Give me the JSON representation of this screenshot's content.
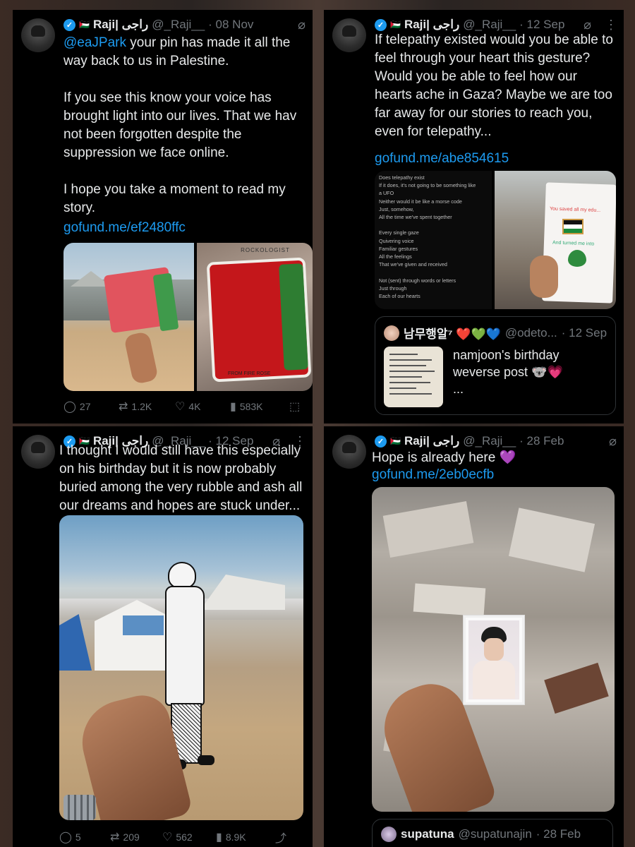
{
  "tweets": [
    {
      "display_name": "Raji| راجى",
      "flag": "🇵🇸",
      "handle": "@_Raji__",
      "date": "· 08 Nov",
      "mention": "@eaJPark",
      "text_after_mention": " your pin has made it all the way back to us in Palestine.\n\nIf you see this know your voice has brought light into our lives. That we hav not been forgotten despite the suppression we face online.\n\nI hope you take a moment to read my story.",
      "link": "gofund.me/ef2480ffc",
      "replies": "27",
      "reposts": "1.2K",
      "likes": "4K",
      "views": "583K",
      "image_text": "ROCKOLOGIST",
      "image_text2": "FROM FIRE ROSE"
    },
    {
      "display_name": "Raji| راجى",
      "flag": "🇵🇸",
      "handle": "@_Raji__",
      "date": "· 12 Sep",
      "text": "If telepathy existed would you be able to feel through your heart this gesture? Would you be able to feel how our hearts ache in Gaza? Maybe we are too far away for our stories to reach you, even for telepathy...",
      "link": "gofund.me/abe854615",
      "poem": [
        "Does telepathy exist",
        "If it does, it's not going to be something like",
        "a UFO",
        "Neither would it be like a morse code",
        "Just, somehow,",
        "All the time we've spent together",
        "",
        "Every single gaze",
        "Quivering voice",
        "Familiar gestures",
        "All the feelings",
        "That we've given and received",
        "",
        "Not (sent) through words or letters",
        "Just through",
        "Each of our hearts"
      ],
      "drawing_text1": "You saved all my edu...",
      "drawing_text2": "And turned me into",
      "quote": {
        "name": "남무행알⁷ ❤️💚💙",
        "handle": "@odeto...",
        "date": "· 12 Sep",
        "text": "namjoon's birthday weverse post 🐨💗\n..."
      }
    },
    {
      "display_name": "Raji| راجى",
      "flag": "🇵🇸",
      "handle": "@_Raji__",
      "date": "· 12 Sep",
      "text": "I thought I would still have this especially on his birthday but it is now probably buried among the very rubble and ash all our dreams and hopes are stuck under...",
      "replies": "5",
      "reposts": "209",
      "likes": "562",
      "views": "8.9K"
    },
    {
      "display_name": "Raji| راجى",
      "flag": "🇵🇸",
      "handle": "@_Raji__",
      "date": "· 28 Feb",
      "text": "Hope is already here 💜",
      "link": "gofund.me/2eb0ecfb",
      "quote": {
        "name": "supatuna",
        "handle": "@supatunajin",
        "date": "· 28 Feb"
      }
    }
  ],
  "icons": {
    "verified": "verified-badge-icon",
    "grok": "grok-icon",
    "more": "more-icon",
    "reply": "reply-icon",
    "repost": "repost-icon",
    "like": "like-icon",
    "views": "views-icon",
    "bookmark": "bookmark-icon",
    "share": "share-icon"
  },
  "colors": {
    "background": "#000000",
    "text": "#e7e9ea",
    "muted": "#71767b",
    "link": "#1d9bf0"
  }
}
